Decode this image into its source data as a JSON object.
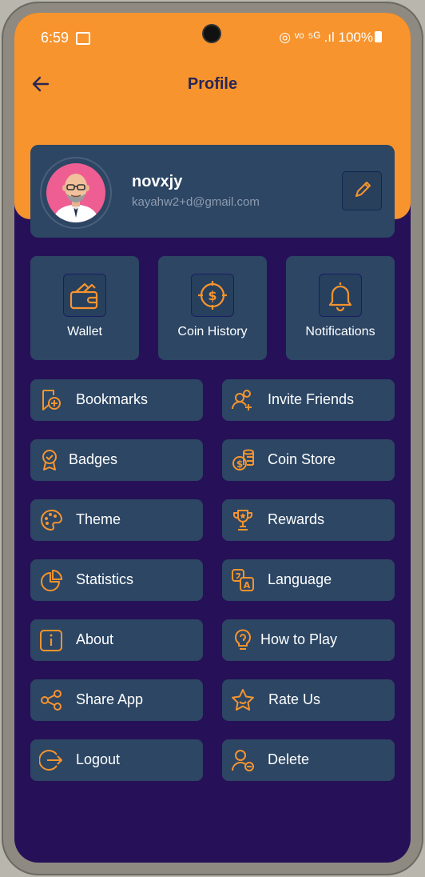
{
  "status_bar": {
    "time": "6:59",
    "right_text": "100%",
    "signal_text": "◎ ᵛᵒ ⁵ᴳ .ıl"
  },
  "header": {
    "title": "Profile"
  },
  "profile": {
    "name": "novxjy",
    "email": "kayahw2+d@gmail.com"
  },
  "quick_actions": [
    {
      "label": "Wallet",
      "icon": "wallet-icon"
    },
    {
      "label": "Coin History",
      "icon": "coin-history-icon"
    },
    {
      "label": "Notifications",
      "icon": "bell-icon"
    }
  ],
  "menu": {
    "left": [
      {
        "label": "Bookmarks",
        "icon": "bookmark-add-icon"
      },
      {
        "label": "Badges",
        "icon": "badge-icon"
      },
      {
        "label": "Theme",
        "icon": "palette-icon"
      },
      {
        "label": "Statistics",
        "icon": "pie-chart-icon"
      },
      {
        "label": "About",
        "icon": "info-icon"
      },
      {
        "label": "Share App",
        "icon": "share-icon"
      },
      {
        "label": "Logout",
        "icon": "logout-icon"
      }
    ],
    "right": [
      {
        "label": "Invite Friends",
        "icon": "add-user-icon"
      },
      {
        "label": "Coin Store",
        "icon": "coin-store-icon"
      },
      {
        "label": "Rewards",
        "icon": "trophy-icon"
      },
      {
        "label": "Language",
        "icon": "language-icon"
      },
      {
        "label": "How to Play",
        "icon": "help-icon"
      },
      {
        "label": "Rate Us",
        "icon": "star-icon"
      },
      {
        "label": "Delete",
        "icon": "delete-user-icon"
      }
    ]
  },
  "colors": {
    "accent": "#f7942e",
    "background": "#261158",
    "card": "#2c4664",
    "title": "#2a2653"
  }
}
